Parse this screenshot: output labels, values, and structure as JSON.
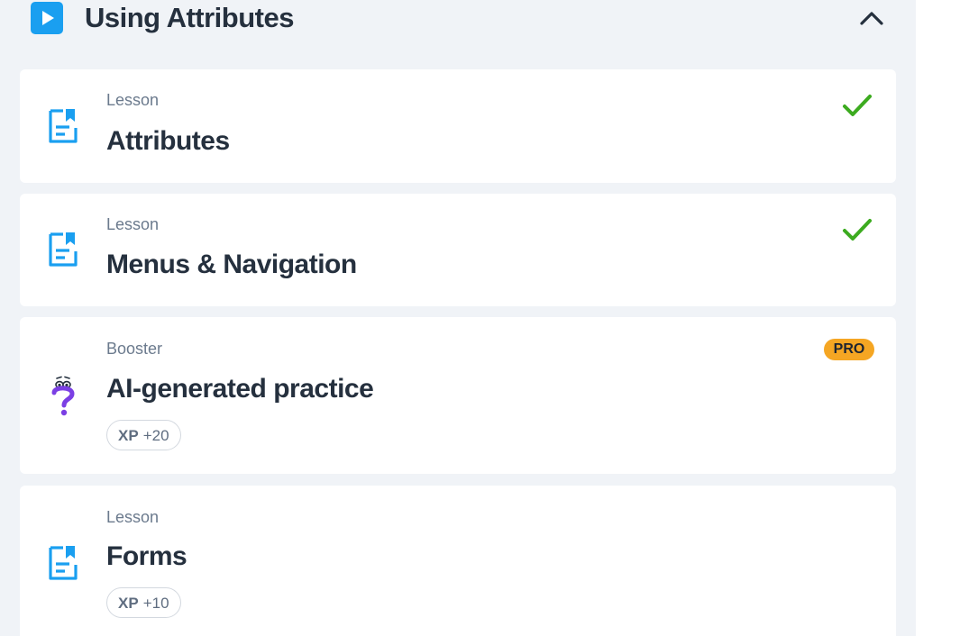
{
  "section": {
    "title": "Using Attributes",
    "icon": "play-icon",
    "collapse_icon": "chevron-up-icon",
    "accent_color": "#1a9ff0"
  },
  "items": [
    {
      "type": "Lesson",
      "title": "Attributes",
      "icon": "lesson-document-icon",
      "status": "completed"
    },
    {
      "type": "Lesson",
      "title": "Menus & Navigation",
      "icon": "lesson-document-icon",
      "status": "completed"
    },
    {
      "type": "Booster",
      "title": "AI-generated practice",
      "icon": "question-mark-icon",
      "badge": "PRO",
      "xp_label": "XP",
      "xp_value": "+20"
    },
    {
      "type": "Lesson",
      "title": "Forms",
      "icon": "lesson-document-icon",
      "xp_label": "XP",
      "xp_value": "+10"
    }
  ],
  "colors": {
    "check": "#3cab1f",
    "pro_badge": "#f5a623",
    "booster_icon": "#7b3fe4"
  }
}
